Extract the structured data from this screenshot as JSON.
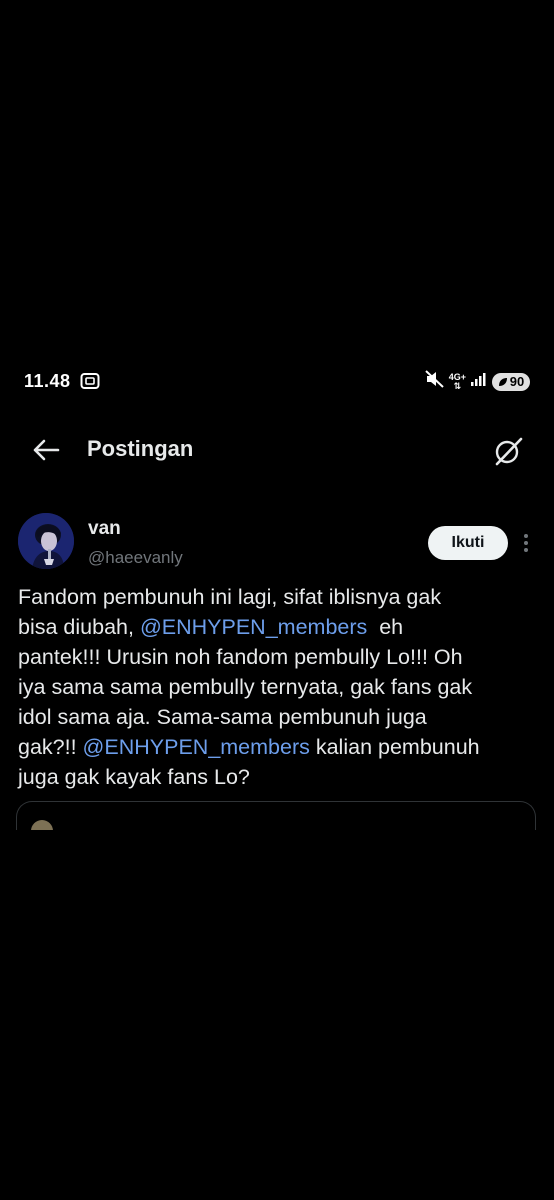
{
  "status_bar": {
    "time": "11.48",
    "network": "4G+",
    "battery": "90",
    "icons": [
      "screenshot-icon",
      "mute-icon",
      "signal-icon",
      "battery-icon"
    ]
  },
  "header": {
    "title": "Postingan",
    "back_icon": "back-arrow-icon",
    "grok_icon": "grok-icon"
  },
  "post": {
    "author": {
      "display_name": "van",
      "handle": "@haeevanly"
    },
    "follow_label": "Ikuti",
    "more_icon": "more-vertical-icon",
    "text_lines": [
      [
        {
          "t": "Fandom pembunuh ini lagi, sifat iblisnya gak"
        }
      ],
      [
        {
          "t": "bisa diubah, "
        },
        {
          "m": "@ENHYPEN_members"
        },
        {
          "t": "  eh"
        }
      ],
      [
        {
          "t": "pantek!!! Urusin noh fandom pembully Lo!!! Oh"
        }
      ],
      [
        {
          "t": "iya sama sama pembully ternyata, gak fans gak"
        }
      ],
      [
        {
          "t": "idol sama aja. Sama-sama pembunuh juga"
        }
      ],
      [
        {
          "t": "gak?!! "
        },
        {
          "m": "@ENHYPEN_members"
        },
        {
          "t": " kalian pembunuh"
        }
      ],
      [
        {
          "t": "juga gak kayak fans Lo?"
        }
      ]
    ]
  },
  "quote": {
    "display_name": "",
    "meta": ""
  },
  "colors": {
    "background": "#000000",
    "text": "#e7e9ea",
    "secondary": "#71767b",
    "link": "#6d9eeb",
    "follow_bg": "#eff3f4"
  }
}
